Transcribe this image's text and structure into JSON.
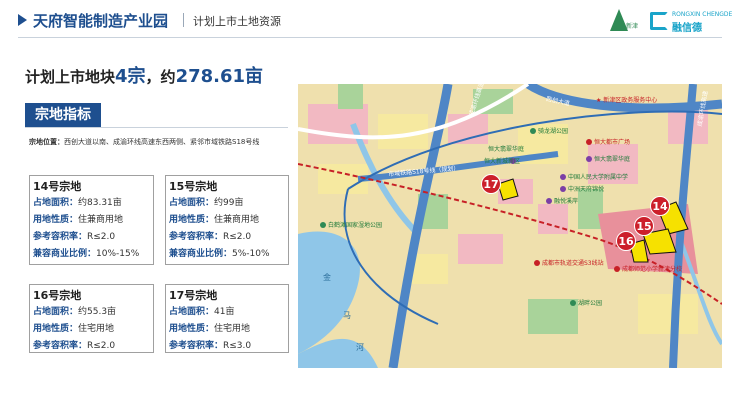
{
  "header": {
    "title": "天府智能制造产业园",
    "subtitle": "计划上市土地资源",
    "logo_left_text": "新津",
    "logo_right_en": "RONGXIN CHENGDE",
    "logo_right_cn": "融信德"
  },
  "headline": {
    "prefix": "计划上市地块",
    "count": "4宗",
    "middle": "，约",
    "area": "278.61亩"
  },
  "section_title": "宗地指标",
  "location": {
    "label": "宗地位置：",
    "text": "西创大道以南、成渝环线高速东西两侧、紧邻市域铁路S18号线"
  },
  "parcels": [
    {
      "title": "14号宗地",
      "rows": [
        {
          "k": "占地面积：",
          "v": "约83.31亩"
        },
        {
          "k": "用地性质：",
          "v": "住兼商用地"
        },
        {
          "k": "参考容积率：",
          "v": "R≤2.0"
        },
        {
          "k": "兼容商业比例：",
          "v": "10%-15%"
        }
      ]
    },
    {
      "title": "15号宗地",
      "rows": [
        {
          "k": "占地面积：",
          "v": "约99亩"
        },
        {
          "k": "用地性质：",
          "v": "住兼商用地"
        },
        {
          "k": "参考容积率：",
          "v": "R≤2.0"
        },
        {
          "k": "兼容商业比例：",
          "v": "5%-10%"
        }
      ]
    },
    {
      "title": "16号宗地",
      "rows": [
        {
          "k": "占地面积：",
          "v": "约55.3亩"
        },
        {
          "k": "用地性质：",
          "v": "住宅用地"
        },
        {
          "k": "参考容积率：",
          "v": "R≤2.0"
        }
      ]
    },
    {
      "title": "17号宗地",
      "rows": [
        {
          "k": "占地面积：",
          "v": "41亩"
        },
        {
          "k": "用地性质：",
          "v": "住宅用地"
        },
        {
          "k": "参考容积率：",
          "v": "R≤3.0"
        }
      ]
    }
  ],
  "map": {
    "roads": {
      "xichuang": "西创大道",
      "chengyu": "成渝环线高速",
      "s18": "市域铁路S18号线（规划）"
    },
    "pois": {
      "gov_center": "新津区政务服务中心",
      "qilong_park": "骑龙湖公园",
      "hengda": "恒大翡翠华庭",
      "hengda2": "恒大新城新区",
      "hengda_square": "恒大都市广场",
      "school": "中国人民大学附属中学",
      "hospital": "中洲天府锦悦",
      "yuexi": "融悦溪岸",
      "bailu_park": "白鹤滩国家湿地公园",
      "metro_station": "成都市轨道交通S3线站",
      "primary_school": "成都师范小学新津分校",
      "lake_park": "湖畔公园",
      "jinjiang": "金",
      "river1": "马",
      "river2": "河"
    },
    "badges": [
      "17",
      "14",
      "15",
      "16"
    ],
    "colors": {
      "parcel_fill": "#f6e100",
      "badge_red": "#cc1f2a",
      "road_blue": "#4f86c6",
      "water": "#8fc6e8"
    }
  }
}
